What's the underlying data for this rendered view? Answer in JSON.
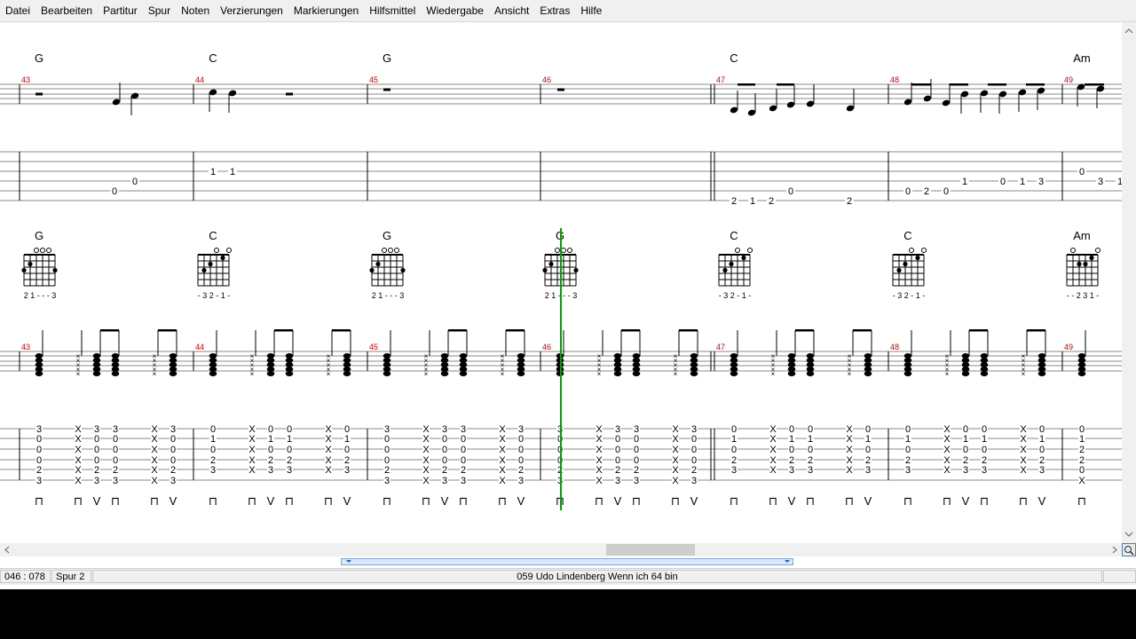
{
  "menu": [
    "Datei",
    "Bearbeiten",
    "Partitur",
    "Spur",
    "Noten",
    "Verzierungen",
    "Markierungen",
    "Hilfsmittel",
    "Wiedergabe",
    "Ansicht",
    "Extras",
    "Hilfe"
  ],
  "system1": {
    "chords": [
      {
        "measure": "43",
        "name": "G"
      },
      {
        "measure": "44",
        "name": "C"
      },
      {
        "measure": "45",
        "name": "G"
      },
      {
        "measure": "46",
        "name": ""
      },
      {
        "measure": "47",
        "name": "C"
      },
      {
        "measure": "48",
        "name": ""
      },
      {
        "measure": "49",
        "name": "Am"
      }
    ],
    "tab_numbers": [
      {
        "measure": "43",
        "string": 4,
        "fret": "0"
      },
      {
        "measure": "43",
        "string": 3,
        "fret": "0"
      },
      {
        "measure": "44",
        "string": 2,
        "fret": "1"
      },
      {
        "measure": "44",
        "string": 2,
        "fret": "1"
      },
      {
        "measure": "47",
        "string": 5,
        "fret": "2"
      },
      {
        "measure": "47",
        "string": 5,
        "fret": "1"
      },
      {
        "measure": "47",
        "string": 5,
        "fret": "2"
      },
      {
        "measure": "47",
        "string": 4,
        "fret": "0"
      },
      {
        "measure": "47",
        "string": 5,
        "fret": "2"
      },
      {
        "measure": "48",
        "string": 4,
        "fret": "0"
      },
      {
        "measure": "48",
        "string": 4,
        "fret": "2"
      },
      {
        "measure": "48",
        "string": 4,
        "fret": "0"
      },
      {
        "measure": "48",
        "string": 3,
        "fret": "1"
      },
      {
        "measure": "48",
        "string": 3,
        "fret": "0"
      },
      {
        "measure": "48",
        "string": 3,
        "fret": "1"
      },
      {
        "measure": "48",
        "string": 3,
        "fret": "3"
      },
      {
        "measure": "49",
        "string": 2,
        "fret": "0"
      },
      {
        "measure": "49",
        "string": 3,
        "fret": "3"
      },
      {
        "measure": "49",
        "string": 3,
        "fret": "1"
      }
    ]
  },
  "system2": {
    "chords": [
      {
        "measure": "43",
        "name": "G",
        "fingering": "21---3"
      },
      {
        "measure": "44",
        "name": "C",
        "fingering": "-32-1-"
      },
      {
        "measure": "45",
        "name": "G",
        "fingering": "21---3"
      },
      {
        "measure": "46",
        "name": "G",
        "fingering": "21---3"
      },
      {
        "measure": "47",
        "name": "C",
        "fingering": "-32-1-"
      },
      {
        "measure": "48",
        "name": "C",
        "fingering": "-32-1-"
      },
      {
        "measure": "49",
        "name": "Am",
        "fingering": "--231-"
      }
    ],
    "strum_columns": {
      "G": [
        "3",
        "0",
        "0",
        "0",
        "2",
        "3"
      ],
      "C": [
        "0",
        "1",
        "0",
        "2",
        "3",
        ""
      ],
      "Am": [
        "0",
        "1",
        "2",
        "2",
        "0",
        "X"
      ]
    },
    "dead": "X",
    "strokes": [
      "⊓",
      "⊓",
      "V",
      "⊓",
      "⊓",
      "V"
    ]
  },
  "status": {
    "position": "046 : 078",
    "track": "Spur 2",
    "song": "059  Udo Lindenberg   Wenn ich 64 bin"
  },
  "colors": {
    "measure_number": "#d40000",
    "cursor": "#00a000",
    "staff": "#8a8a8a"
  }
}
